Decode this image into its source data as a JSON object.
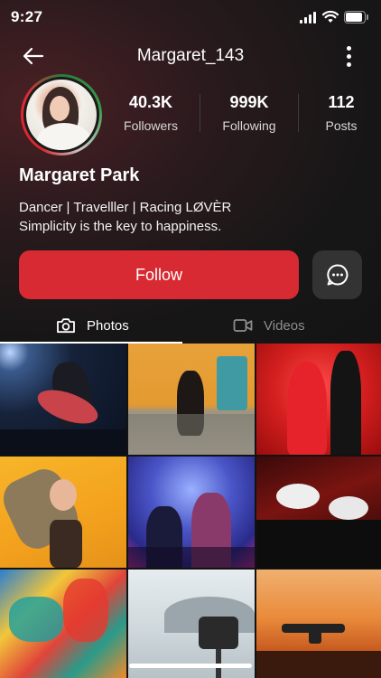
{
  "status_bar": {
    "time": "9:27"
  },
  "header": {
    "username": "Margaret_143"
  },
  "stats": [
    {
      "value": "40.3K",
      "label": "Followers"
    },
    {
      "value": "999K",
      "label": "Following"
    },
    {
      "value": "112",
      "label": "Posts"
    }
  ],
  "profile": {
    "name": "Margaret Park",
    "bio_line1": "Dancer | Travelller | Racing LØVÈR",
    "bio_line2": "Simplicity is the key to happiness."
  },
  "actions": {
    "follow_label": "Follow"
  },
  "tabs": [
    {
      "label": "Photos",
      "active": true
    },
    {
      "label": "Videos",
      "active": false
    }
  ],
  "grid": {
    "photos": [
      "tango-dancers-spotlight",
      "couple-dancing-yellow-wall",
      "couple-red-dress",
      "dancer-orange-background",
      "concert-crowd",
      "drummers-stage",
      "abstract-paint",
      "action-camera-tripod",
      "drone-sunset"
    ]
  },
  "colors": {
    "accent": "#d72a33",
    "active_tab": "#ffffff",
    "inactive_tab": "#8e8e8e"
  }
}
